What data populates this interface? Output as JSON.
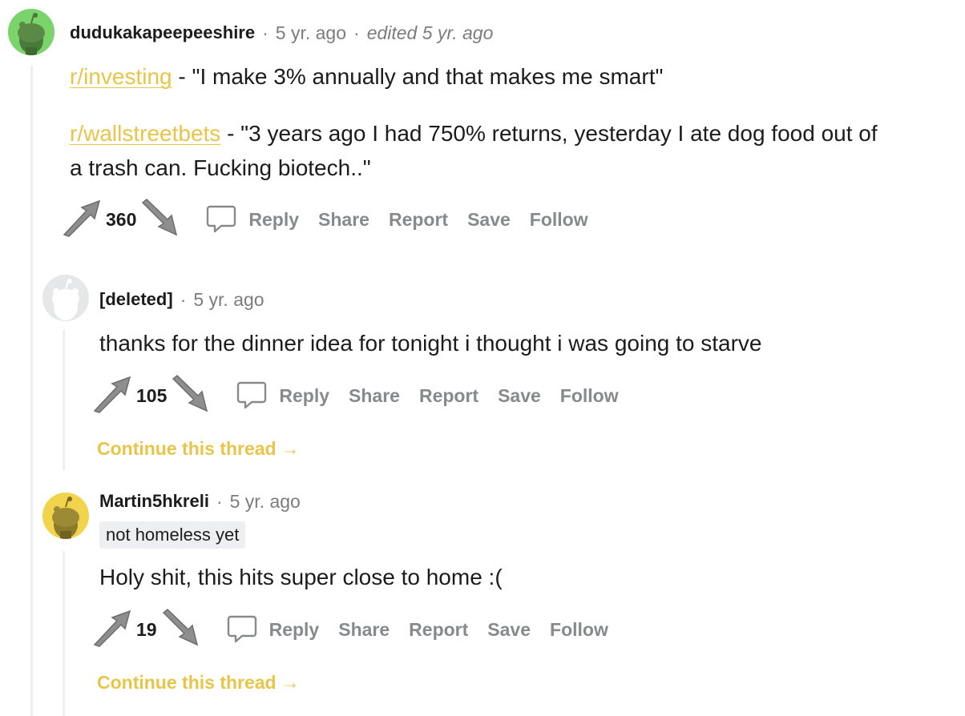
{
  "comments": [
    {
      "author": "dudukakapeepeeshire",
      "time": "5 yr. ago",
      "edited": "edited 5 yr. ago",
      "lines": [
        {
          "link": "r/investing",
          "text": " - \"I make 3% annually and that makes me smart\""
        },
        {
          "link": "r/wallstreetbets",
          "text": " - \"3 years ago I had 750% returns, yesterday I ate dog food out of"
        },
        {
          "text": "a trash can. Fucking biotech..\""
        }
      ],
      "score": "360",
      "avatar_color": "#7bd36b"
    },
    {
      "author": "[deleted]",
      "time": "5 yr. ago",
      "text": "thanks for the dinner idea for tonight i thought i was going to starve",
      "score": "105",
      "continue": "Continue this thread",
      "avatar_color": "#e6e7e8"
    },
    {
      "author": "Martin5hkreli",
      "time": "5 yr. ago",
      "flair": "not homeless yet",
      "text": "Holy shit, this hits super close to home :(",
      "score": "19",
      "continue": "Continue this thread",
      "avatar_color": "#f2d44c"
    }
  ],
  "actions": {
    "reply": "Reply",
    "share": "Share",
    "report": "Report",
    "save": "Save",
    "follow": "Follow"
  },
  "separator": "·",
  "arrow": "→",
  "colors": {
    "link": "#e8c547",
    "muted": "#878a8c",
    "thread_line": "#edeff1"
  }
}
